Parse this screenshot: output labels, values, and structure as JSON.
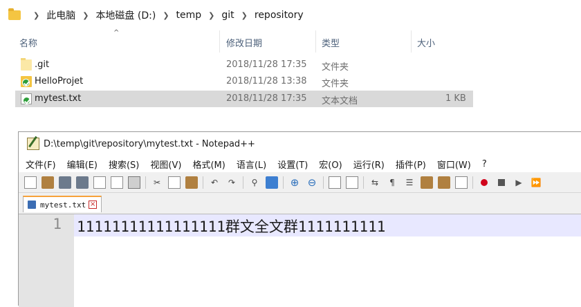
{
  "explorer": {
    "breadcrumb": [
      "此电脑",
      "本地磁盘 (D:)",
      "temp",
      "git",
      "repository"
    ],
    "columns": {
      "name": "名称",
      "date": "修改日期",
      "type": "类型",
      "size": "大小"
    },
    "files": [
      {
        "name": ".git",
        "date": "2018/11/28 17:35",
        "type": "文件夹",
        "size": ""
      },
      {
        "name": "HelloProjet",
        "date": "2018/11/28 13:38",
        "type": "文件夹",
        "size": ""
      },
      {
        "name": "mytest.txt",
        "date": "2018/11/28 17:35",
        "type": "文本文档",
        "size": "1 KB"
      }
    ]
  },
  "notepad": {
    "title": "D:\\temp\\git\\repository\\mytest.txt - Notepad++",
    "menu": [
      "文件(F)",
      "编辑(E)",
      "搜索(S)",
      "视图(V)",
      "格式(M)",
      "语言(L)",
      "设置(T)",
      "宏(O)",
      "运行(R)",
      "插件(P)",
      "窗口(W)",
      "?"
    ],
    "tab": {
      "label": "mytest.txt",
      "close": "×"
    },
    "line_number": "1",
    "content": "11111111111111111群文全文群1111111111"
  },
  "colors": {
    "tab_accent": "#f7a23a",
    "current_line": "#e8e8ff",
    "selection": "#d9d9d9"
  }
}
